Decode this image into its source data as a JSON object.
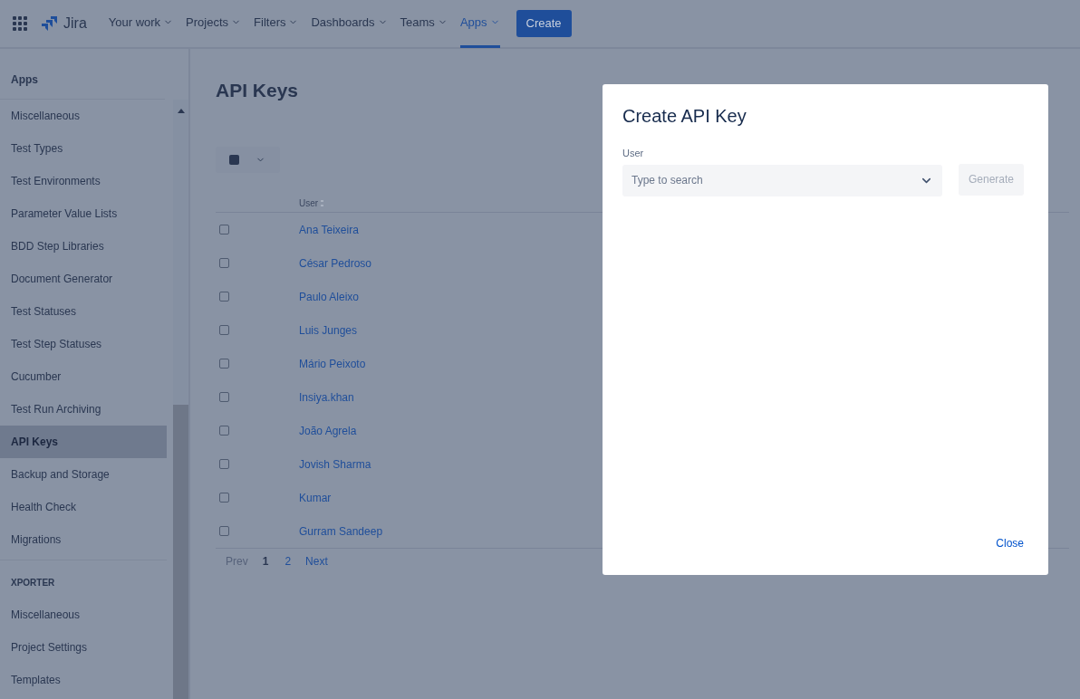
{
  "nav": {
    "app_name": "Jira",
    "items": [
      {
        "label": "Your work",
        "selected": false
      },
      {
        "label": "Projects",
        "selected": false
      },
      {
        "label": "Filters",
        "selected": false
      },
      {
        "label": "Dashboards",
        "selected": false
      },
      {
        "label": "Teams",
        "selected": false
      },
      {
        "label": "Apps",
        "selected": true
      }
    ],
    "create": "Create"
  },
  "sidebar": {
    "title": "Apps",
    "groups": [
      {
        "items": [
          {
            "label": "Miscellaneous",
            "selected": false
          },
          {
            "label": "Test Types",
            "selected": false
          },
          {
            "label": "Test Environments",
            "selected": false
          },
          {
            "label": "Parameter Value Lists",
            "selected": false
          },
          {
            "label": "BDD Step Libraries",
            "selected": false
          },
          {
            "label": "Document Generator",
            "selected": false
          },
          {
            "label": "Test Statuses",
            "selected": false
          },
          {
            "label": "Test Step Statuses",
            "selected": false
          },
          {
            "label": "Cucumber",
            "selected": false
          },
          {
            "label": "Test Run Archiving",
            "selected": false
          },
          {
            "label": "API Keys",
            "selected": true
          },
          {
            "label": "Backup and Storage",
            "selected": false
          },
          {
            "label": "Health Check",
            "selected": false
          },
          {
            "label": "Migrations",
            "selected": false
          }
        ]
      },
      {
        "heading": "XPORTER",
        "items": [
          {
            "label": "Miscellaneous",
            "selected": false
          },
          {
            "label": "Project Settings",
            "selected": false
          },
          {
            "label": "Templates",
            "selected": false
          }
        ]
      }
    ]
  },
  "page": {
    "title": "API Keys",
    "table": {
      "columns": [
        "User"
      ],
      "rows": [
        {
          "user": "Ana Teixeira",
          "checked": false
        },
        {
          "user": "César Pedroso",
          "checked": false
        },
        {
          "user": "Paulo Aleixo",
          "checked": false
        },
        {
          "user": "Luis Junges",
          "checked": false
        },
        {
          "user": "Mário Peixoto",
          "checked": false
        },
        {
          "user": "Insiya.khan",
          "checked": false
        },
        {
          "user": "João Agrela",
          "checked": false
        },
        {
          "user": "Jovish Sharma",
          "checked": false
        },
        {
          "user": "Kumar",
          "checked": false
        },
        {
          "user": "Gurram Sandeep",
          "checked": false
        }
      ]
    },
    "pagination": {
      "prev": {
        "label": "Prev",
        "disabled": true
      },
      "pages": [
        {
          "label": "1",
          "selected": true
        },
        {
          "label": "2",
          "selected": false
        }
      ],
      "next": {
        "label": "Next",
        "disabled": false
      }
    }
  },
  "dialog": {
    "title": "Create API Key",
    "field": {
      "label": "User",
      "placeholder": "Type to search"
    },
    "generate": {
      "label": "Generate",
      "disabled": true
    },
    "close": "Close"
  }
}
